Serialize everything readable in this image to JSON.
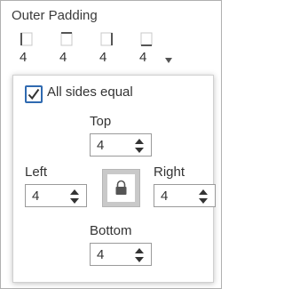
{
  "section": {
    "title": "Outer Padding"
  },
  "padding_sides": [
    {
      "side": "left",
      "icon": "left-padding-icon",
      "value": "4"
    },
    {
      "side": "top",
      "icon": "top-padding-icon",
      "value": "4"
    },
    {
      "side": "right",
      "icon": "right-padding-icon",
      "value": "4"
    },
    {
      "side": "bottom",
      "icon": "bottom-padding-icon",
      "value": "4"
    }
  ],
  "panel": {
    "all_sides_equal": {
      "label": "All sides equal",
      "checked": true
    },
    "top": {
      "label": "Top",
      "value": "4"
    },
    "left": {
      "label": "Left",
      "value": "4"
    },
    "right": {
      "label": "Right",
      "value": "4"
    },
    "bottom": {
      "label": "Bottom",
      "value": "4"
    },
    "lock_icon": "lock-icon"
  },
  "colors": {
    "accent": "#2f6ab0",
    "lock_bg": "#c9c9c9"
  }
}
